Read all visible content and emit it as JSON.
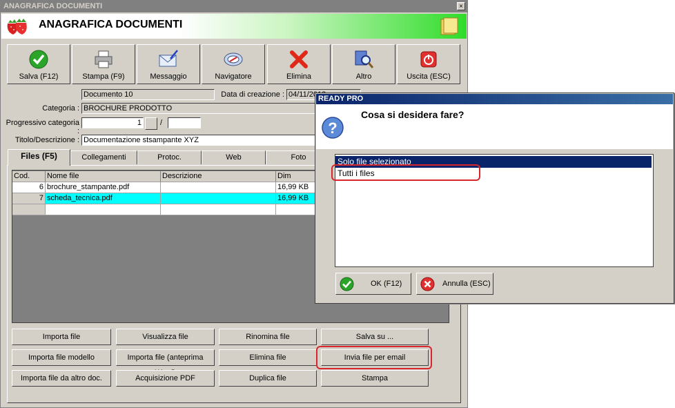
{
  "main_window": {
    "title": "ANAGRAFICA DOCUMENTI",
    "header_title": "ANAGRAFICA DOCUMENTI",
    "close_glyph": "×"
  },
  "toolbar": {
    "buttons": [
      {
        "label": "Salva (F12)",
        "icon": "check-icon"
      },
      {
        "label": "Stampa (F9)",
        "icon": "printer-icon"
      },
      {
        "label": "Messaggio",
        "icon": "envelope-icon"
      },
      {
        "label": "Navigatore",
        "icon": "compass-icon"
      },
      {
        "label": "Elimina",
        "icon": "delete-icon"
      },
      {
        "label": "Altro",
        "icon": "magnifier-icon"
      },
      {
        "label": "Uscita (ESC)",
        "icon": "power-icon"
      }
    ]
  },
  "form": {
    "document_value": "Documento 10",
    "creation_date_label": "Data di creazione :",
    "creation_date_value": "04/11/2013",
    "category_label": "Categoria :",
    "category_value": "BROCHURE PRODOTTO",
    "progressive_label": "Progressivo categoria :",
    "progressive_value": "1",
    "progressive_separator": "/",
    "title_label": "Titolo/Descrizione :",
    "title_value": "Documentazione stsampante XYZ"
  },
  "tabs": [
    "Files (F5)",
    "Collegamenti",
    "Protoc.",
    "Web",
    "Foto"
  ],
  "file_table": {
    "columns": [
      "Cod.",
      "Nome file",
      "Descrizione",
      "Dim"
    ],
    "rows": [
      {
        "cod": "6",
        "name": "brochure_stampante.pdf",
        "description": "",
        "size": "16,99 KB"
      },
      {
        "cod": "7",
        "name": "scheda_tecnica.pdf",
        "description": "",
        "size": "16,99 KB"
      }
    ]
  },
  "actions": {
    "import_file": "Importa file",
    "view_file": "Visualizza file",
    "rename_file": "Rinomina file",
    "save_to": "Salva su ...",
    "import_template": "Importa file modello",
    "import_word_preview": "Importa file (anteprima Word)",
    "delete_file": "Elimina file",
    "send_email": "Invia file per email",
    "import_other_doc": "Importa file da altro doc.",
    "acquire_pdf": "Acquisizione PDF",
    "duplicate_file": "Duplica file",
    "print": "Stampa"
  },
  "dialog": {
    "title": "READY PRO",
    "question": "Cosa si desidera fare?",
    "options": [
      "Solo file selezionato",
      "Tutti i files"
    ],
    "selected_option_index": 0,
    "ok_label": "OK (F12)",
    "cancel_label": "Annulla (ESC)"
  },
  "colors": {
    "window_bg": "#d4d0c8",
    "selected_row": "#00ffff",
    "selection_blue": "#0a246a",
    "highlight_red": "#d8262c",
    "banner_green": "#2fdc2a"
  }
}
